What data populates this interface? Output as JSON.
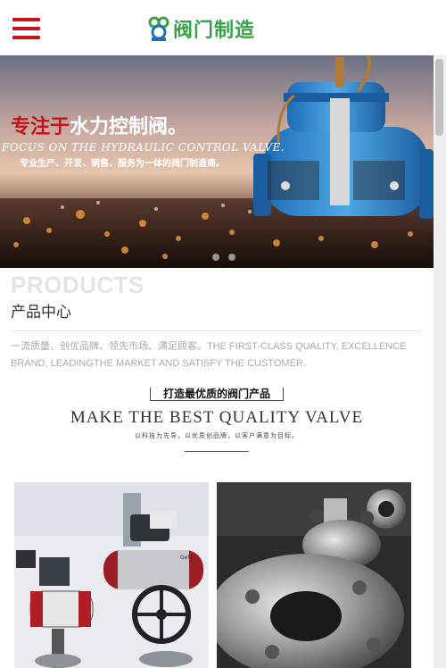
{
  "header": {
    "menu_icon": "hamburger-menu-icon",
    "logo_icon": "valve-logo-icon",
    "logo_text": "阀门制造",
    "accent_color": "#c0151c",
    "brand_color": "#3aa149"
  },
  "banner": {
    "title_red": "专注于",
    "title_white": "水力控制阀。",
    "title_en": "FOCUS ON THE HYDRAULIC CONTROL VALVE.",
    "subtitle": "专业生产、开发、销售、服务为一体的阀门制造商。",
    "slide_count": 2
  },
  "products": {
    "en_title": "PRODUCTS",
    "cn_title": "产品中心",
    "description": "一流质量、创优品牌、领先市场、满足顾客。THE FIRST-CLASS QUALITY, EXCELLENCE BRAND, LEADINGTHE MARKET AND SATISFY THE CUSTOMER.",
    "tagline_cn": "打造最优质的阀门产品",
    "tagline_en": "MAKE THE BEST QUALITY VALVE",
    "tagline_small": "以科技为先导，以优质创品牌，以客户满意为目标。"
  }
}
